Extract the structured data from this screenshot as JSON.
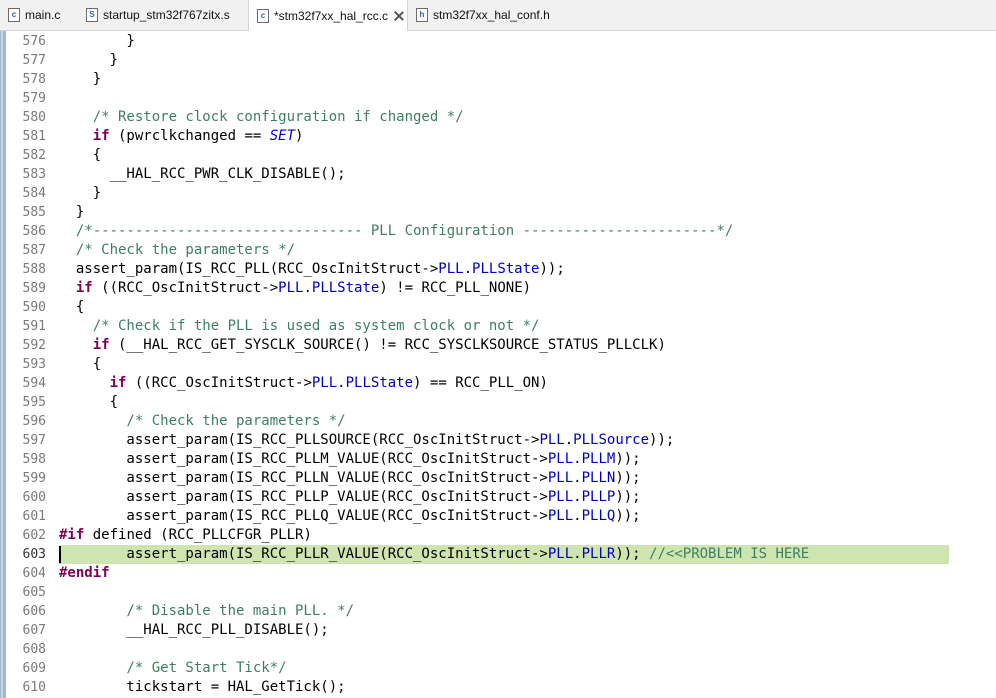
{
  "tabs": [
    {
      "label": "main.c",
      "icon": "c-file-icon",
      "icon_letter": "c",
      "active": false
    },
    {
      "label": "startup_stm32f767zitx.s",
      "icon": "asm-file-icon",
      "icon_letter": "S",
      "active": false
    },
    {
      "label": "*stm32f7xx_hal_rcc.c",
      "icon": "c-file-icon",
      "icon_letter": "c",
      "active": true
    },
    {
      "label": "stm32f7xx_hal_conf.h",
      "icon": "h-file-icon",
      "icon_letter": "h",
      "active": false
    }
  ],
  "editor": {
    "current_line": 603,
    "lines": [
      {
        "n": "576",
        "tokens": [
          [
            "        }",
            "p"
          ]
        ]
      },
      {
        "n": "577",
        "tokens": [
          [
            "      }",
            "p"
          ]
        ]
      },
      {
        "n": "578",
        "tokens": [
          [
            "    }",
            "p"
          ]
        ]
      },
      {
        "n": "579",
        "tokens": []
      },
      {
        "n": "580",
        "tokens": [
          [
            "    /* Restore clock configuration if changed */",
            "cm"
          ]
        ]
      },
      {
        "n": "581",
        "tokens": [
          [
            "    ",
            "p"
          ],
          [
            "if",
            "kw"
          ],
          [
            " (pwrclkchanged == ",
            "p"
          ],
          [
            "SET",
            "en"
          ],
          [
            ")",
            "p"
          ]
        ]
      },
      {
        "n": "582",
        "tokens": [
          [
            "    {",
            "p"
          ]
        ]
      },
      {
        "n": "583",
        "tokens": [
          [
            "      __HAL_RCC_PWR_CLK_DISABLE();",
            "p"
          ]
        ]
      },
      {
        "n": "584",
        "tokens": [
          [
            "    }",
            "p"
          ]
        ]
      },
      {
        "n": "585",
        "tokens": [
          [
            "  }",
            "p"
          ]
        ]
      },
      {
        "n": "586",
        "tokens": [
          [
            "  /*-------------------------------- PLL Configuration -----------------------*/",
            "cm"
          ]
        ]
      },
      {
        "n": "587",
        "tokens": [
          [
            "  /* Check the parameters */",
            "cm"
          ]
        ]
      },
      {
        "n": "588",
        "tokens": [
          [
            "  assert_param(IS_RCC_PLL(RCC_OscInitStruct->",
            "p"
          ],
          [
            "PLL",
            "fld"
          ],
          [
            ".",
            "p"
          ],
          [
            "PLLState",
            "fld"
          ],
          [
            "));",
            "p"
          ]
        ]
      },
      {
        "n": "589",
        "tokens": [
          [
            "  ",
            "p"
          ],
          [
            "if",
            "kw"
          ],
          [
            " ((RCC_OscInitStruct->",
            "p"
          ],
          [
            "PLL",
            "fld"
          ],
          [
            ".",
            "p"
          ],
          [
            "PLLState",
            "fld"
          ],
          [
            ") != RCC_PLL_NONE)",
            "p"
          ]
        ]
      },
      {
        "n": "590",
        "tokens": [
          [
            "  {",
            "p"
          ]
        ]
      },
      {
        "n": "591",
        "tokens": [
          [
            "    /* Check if the PLL is used as system clock or not */",
            "cm"
          ]
        ]
      },
      {
        "n": "592",
        "tokens": [
          [
            "    ",
            "p"
          ],
          [
            "if",
            "kw"
          ],
          [
            " (__HAL_RCC_GET_SYSCLK_SOURCE() != RCC_SYSCLKSOURCE_STATUS_PLLCLK)",
            "p"
          ]
        ]
      },
      {
        "n": "593",
        "tokens": [
          [
            "    {",
            "p"
          ]
        ]
      },
      {
        "n": "594",
        "tokens": [
          [
            "      ",
            "p"
          ],
          [
            "if",
            "kw"
          ],
          [
            " ((RCC_OscInitStruct->",
            "p"
          ],
          [
            "PLL",
            "fld"
          ],
          [
            ".",
            "p"
          ],
          [
            "PLLState",
            "fld"
          ],
          [
            ") == RCC_PLL_ON)",
            "p"
          ]
        ]
      },
      {
        "n": "595",
        "tokens": [
          [
            "      {",
            "p"
          ]
        ]
      },
      {
        "n": "596",
        "tokens": [
          [
            "        /* Check the parameters */",
            "cm"
          ]
        ]
      },
      {
        "n": "597",
        "tokens": [
          [
            "        assert_param(IS_RCC_PLLSOURCE(RCC_OscInitStruct->",
            "p"
          ],
          [
            "PLL",
            "fld"
          ],
          [
            ".",
            "p"
          ],
          [
            "PLLSource",
            "fld"
          ],
          [
            "));",
            "p"
          ]
        ]
      },
      {
        "n": "598",
        "tokens": [
          [
            "        assert_param(IS_RCC_PLLM_VALUE(RCC_OscInitStruct->",
            "p"
          ],
          [
            "PLL",
            "fld"
          ],
          [
            ".",
            "p"
          ],
          [
            "PLLM",
            "fld"
          ],
          [
            "));",
            "p"
          ]
        ]
      },
      {
        "n": "599",
        "tokens": [
          [
            "        assert_param(IS_RCC_PLLN_VALUE(RCC_OscInitStruct->",
            "p"
          ],
          [
            "PLL",
            "fld"
          ],
          [
            ".",
            "p"
          ],
          [
            "PLLN",
            "fld"
          ],
          [
            "));",
            "p"
          ]
        ]
      },
      {
        "n": "600",
        "tokens": [
          [
            "        assert_param(IS_RCC_PLLP_VALUE(RCC_OscInitStruct->",
            "p"
          ],
          [
            "PLL",
            "fld"
          ],
          [
            ".",
            "p"
          ],
          [
            "PLLP",
            "fld"
          ],
          [
            "));",
            "p"
          ]
        ]
      },
      {
        "n": "601",
        "tokens": [
          [
            "        assert_param(IS_RCC_PLLQ_VALUE(RCC_OscInitStruct->",
            "p"
          ],
          [
            "PLL",
            "fld"
          ],
          [
            ".",
            "p"
          ],
          [
            "PLLQ",
            "fld"
          ],
          [
            "));",
            "p"
          ]
        ]
      },
      {
        "n": "602",
        "tokens": [
          [
            "#if",
            "kw"
          ],
          [
            " defined (RCC_PLLCFGR_PLLR)",
            "p"
          ]
        ]
      },
      {
        "n": "603",
        "tokens": [
          [
            "        assert_param(IS_RCC_PLLR_VALUE(RCC_OscInitStruct->",
            "p"
          ],
          [
            "PLL",
            "fld"
          ],
          [
            ".",
            "p"
          ],
          [
            "PLLR",
            "fld"
          ],
          [
            ")); ",
            "p"
          ],
          [
            "//<<PROBLEM IS HERE",
            "cm"
          ]
        ]
      },
      {
        "n": "604",
        "tokens": [
          [
            "#endif",
            "kw"
          ]
        ]
      },
      {
        "n": "605",
        "tokens": []
      },
      {
        "n": "606",
        "tokens": [
          [
            "        /* Disable the main PLL. */",
            "cm"
          ]
        ]
      },
      {
        "n": "607",
        "tokens": [
          [
            "        __HAL_RCC_PLL_DISABLE();",
            "p"
          ]
        ]
      },
      {
        "n": "608",
        "tokens": []
      },
      {
        "n": "609",
        "tokens": [
          [
            "        /* Get Start Tick*/",
            "cm"
          ]
        ]
      },
      {
        "n": "610",
        "tokens": [
          [
            "        tickstart = HAL_GetTick();",
            "p"
          ]
        ]
      }
    ]
  }
}
